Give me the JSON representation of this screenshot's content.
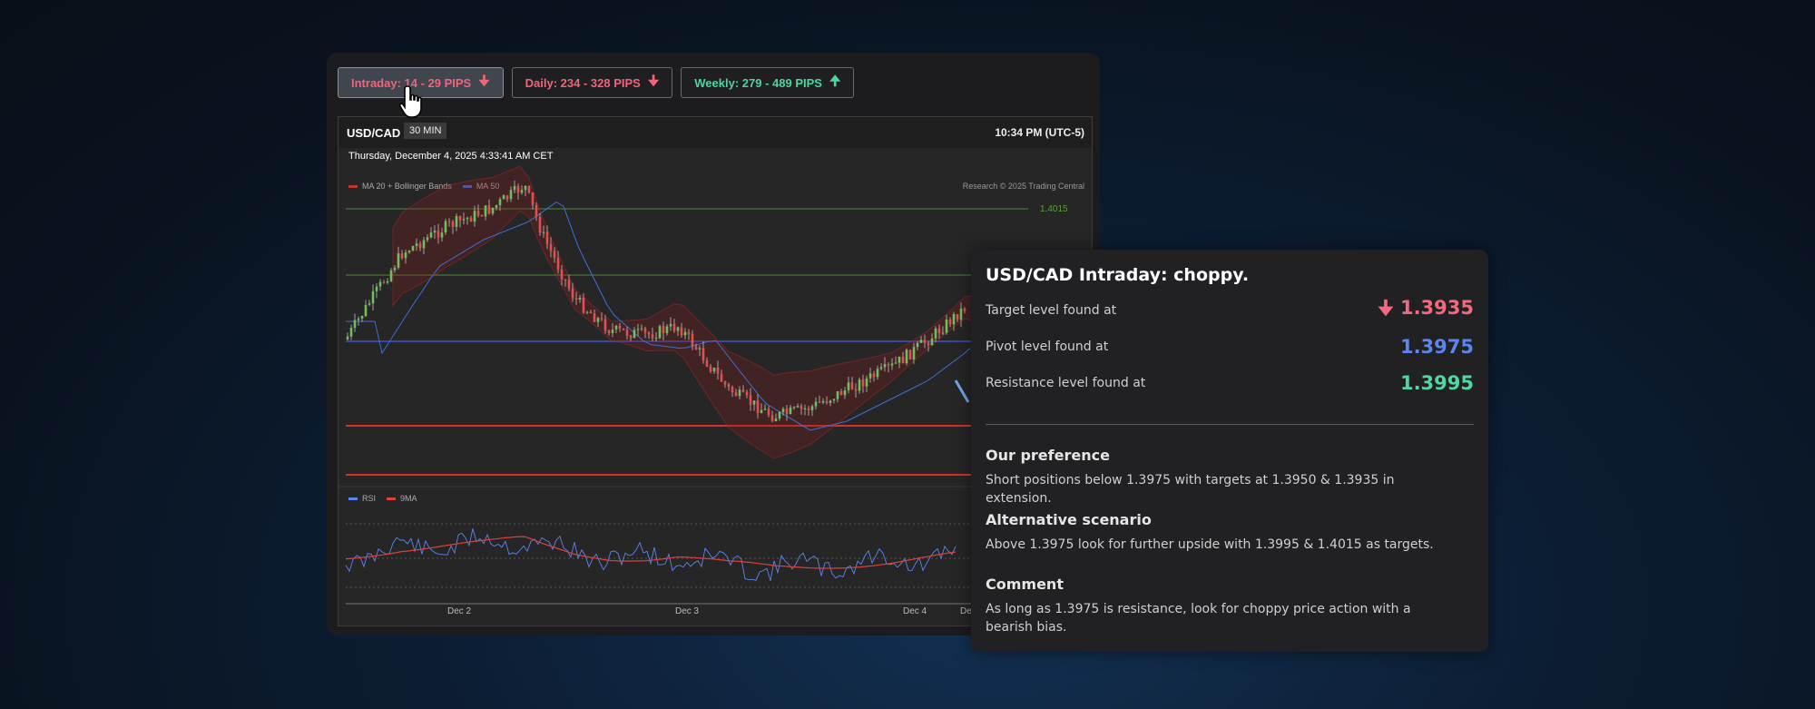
{
  "tabs": [
    {
      "label": "Intraday: 14 - 29 PIPS",
      "direction": "down",
      "active": true,
      "color": "#f0647c"
    },
    {
      "label": "Daily: 234 - 328 PIPS",
      "direction": "down",
      "active": false,
      "color": "#f0647c"
    },
    {
      "label": "Weekly: 279 - 489 PIPS",
      "direction": "up",
      "active": false,
      "color": "#4bd6a0"
    }
  ],
  "chart": {
    "symbol": "USD/CAD",
    "interval": "30 MIN",
    "clock": "10:34 PM (UTC-5)",
    "datetime": "Thursday, December 4, 2025 4:33:41 AM CET",
    "legend": [
      {
        "name": "MA 20 + Bollinger Bands",
        "color": "#c0392b"
      },
      {
        "name": "MA 50",
        "color": "#3b6fd1"
      }
    ],
    "research": "Research © 2025 Trading Central",
    "level_label": "1.4015",
    "rsi_legend": [
      {
        "name": "RSI",
        "color": "#5a86f0"
      },
      {
        "name": "9MA",
        "color": "#e0413a"
      }
    ],
    "x_labels": [
      "Dec 2",
      "Dec 3",
      "Dec 4",
      "Dec"
    ]
  },
  "card": {
    "title": "USD/CAD Intraday: choppy.",
    "levels": [
      {
        "label": "Target level found at",
        "value": "1.3935",
        "icon": "arrow-down-icon",
        "color": "#f26a80"
      },
      {
        "label": "Pivot level found at",
        "value": "1.3975",
        "color": "#5a86f0"
      },
      {
        "label": "Resistance level found at",
        "value": "1.3995",
        "color": "#4fd6a1"
      }
    ],
    "sections": [
      {
        "title": "Our preference",
        "text": "Short positions below 1.3975 with targets at 1.3950 & 1.3935 in extension."
      },
      {
        "title": "Alternative scenario",
        "text": "Above 1.3975 look for further upside with 1.3995 & 1.4015 as targets."
      },
      {
        "title": "Comment",
        "text": "As long as 1.3975 is resistance, look for choppy price action with a bearish bias."
      }
    ]
  },
  "icons": {
    "arrow_down": "arrow-down-icon",
    "arrow_up": "arrow-up-icon",
    "cursor": "hand-pointer-icon"
  }
}
